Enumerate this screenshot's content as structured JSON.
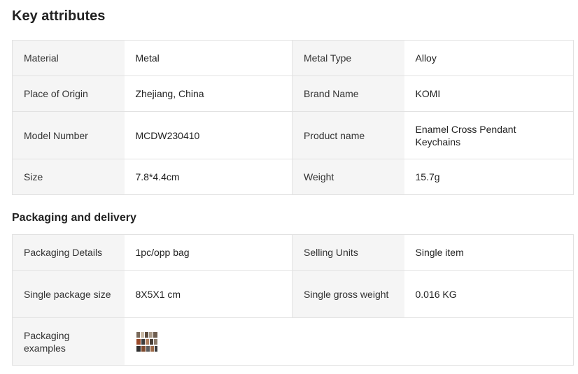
{
  "key_attributes": {
    "title": "Key attributes",
    "rows": [
      [
        {
          "label": "Material",
          "value": "Metal"
        },
        {
          "label": "Metal Type",
          "value": "Alloy"
        }
      ],
      [
        {
          "label": "Place of Origin",
          "value": "Zhejiang, China"
        },
        {
          "label": "Brand Name",
          "value": "KOMI"
        }
      ],
      [
        {
          "label": "Model Number",
          "value": "MCDW230410"
        },
        {
          "label": "Product name",
          "value": "Enamel Cross Pendant Keychains"
        }
      ],
      [
        {
          "label": "Size",
          "value": "7.8*4.4cm"
        },
        {
          "label": "Weight",
          "value": "15.7g"
        }
      ]
    ]
  },
  "packaging": {
    "title": "Packaging and delivery",
    "rows": [
      [
        {
          "label": "Packaging Details",
          "value": "1pc/opp bag"
        },
        {
          "label": "Selling Units",
          "value": "Single item"
        }
      ],
      [
        {
          "label": "Single package size",
          "value": "8X5X1 cm"
        },
        {
          "label": "Single gross weight",
          "value": "0.016 KG"
        }
      ]
    ],
    "examples_label": "Packaging examples",
    "examples_icon": "packaging-thumbnail-image"
  }
}
